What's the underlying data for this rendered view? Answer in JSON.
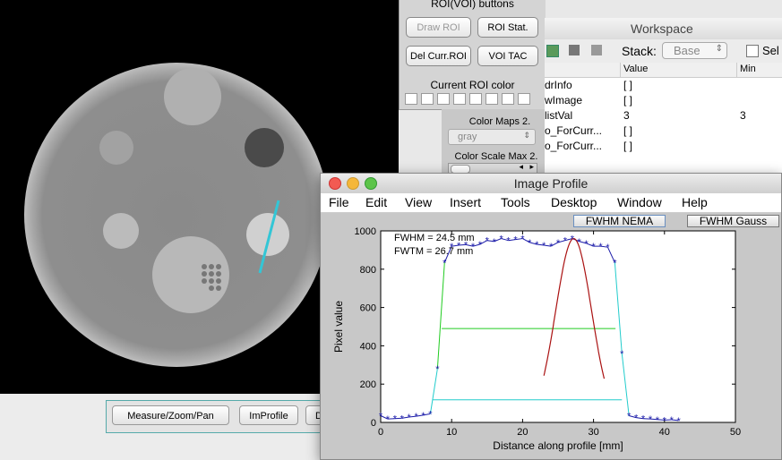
{
  "roi_panel": {
    "title": "ROI(VOI) buttons",
    "draw_roi": "Draw ROI",
    "roi_stat": "ROI Stat.",
    "del_curr_roi": "Del Curr.ROI",
    "voi_tac": "VOI TAC",
    "color_title": "Current ROI color"
  },
  "color_maps": {
    "title": "Color Maps 2.",
    "selected": "gray",
    "scale_title": "Color Scale Max 2."
  },
  "workspace": {
    "title": "Workspace",
    "stack_label": "Stack:",
    "stack_value": "Base",
    "select_label": "Sel",
    "columns": {
      "value": "Value",
      "min": "Min"
    },
    "rows": [
      {
        "name": "drInfo",
        "value": "[ ]",
        "min": ""
      },
      {
        "name": "wImage",
        "value": "[ ]",
        "min": ""
      },
      {
        "name": "listVal",
        "value": "3",
        "min": "3"
      },
      {
        "name": "o_ForCurr...",
        "value": "[ ]",
        "min": ""
      },
      {
        "name": "o_ForCurr...",
        "value": "[ ]",
        "min": ""
      }
    ]
  },
  "bottom_buttons": {
    "measure": "Measure/Zoom/Pan",
    "improfile": "ImProfile",
    "partial": "D"
  },
  "profile_window": {
    "title": "Image Profile",
    "menus": [
      "File",
      "Edit",
      "View",
      "Insert",
      "Tools",
      "Desktop",
      "Window",
      "Help"
    ],
    "fwhm_nema": "FWHM NEMA",
    "fwhm_gauss": "FWHM Gauss"
  },
  "chart_data": {
    "type": "line",
    "xlabel": "Distance along profile [mm]",
    "ylabel": "Pixel value",
    "xlim": [
      0,
      50
    ],
    "ylim": [
      0,
      1000
    ],
    "xticks": [
      0,
      10,
      20,
      30,
      40,
      50
    ],
    "yticks": [
      0,
      200,
      400,
      600,
      800,
      1000
    ],
    "annotations": [
      "FWHM = 24.5 mm",
      "FWTM = 26.7 mm"
    ],
    "colors": {
      "data": "#1a1aa8",
      "fwhm": "#22cc22",
      "fwtm": "#22cccc",
      "gauss": "#aa1111"
    },
    "profile": {
      "x": [
        0,
        1,
        2,
        3,
        4,
        5,
        6,
        7,
        8,
        9,
        10,
        11,
        12,
        13,
        14,
        15,
        16,
        17,
        18,
        19,
        20,
        21,
        22,
        23,
        24,
        25,
        26,
        27,
        28,
        29,
        30,
        31,
        32,
        33,
        34,
        35,
        36,
        37,
        38,
        39,
        40,
        41,
        42
      ],
      "y": [
        35,
        18,
        20,
        22,
        28,
        32,
        38,
        45,
        280,
        835,
        920,
        925,
        928,
        920,
        930,
        950,
        945,
        960,
        950,
        955,
        960,
        940,
        930,
        925,
        920,
        940,
        950,
        960,
        945,
        935,
        920,
        920,
        915,
        835,
        360,
        35,
        25,
        20,
        18,
        15,
        12,
        14,
        10
      ]
    },
    "fwhm_line": {
      "x": [
        8.6,
        33.1
      ],
      "y": 490
    },
    "fwtm_line": {
      "x": [
        7.3,
        34.0
      ],
      "y": 118
    },
    "gauss": {
      "center": 27.2,
      "peak": 960,
      "sigma": 5.2,
      "x_range": [
        23,
        31.5
      ]
    }
  }
}
